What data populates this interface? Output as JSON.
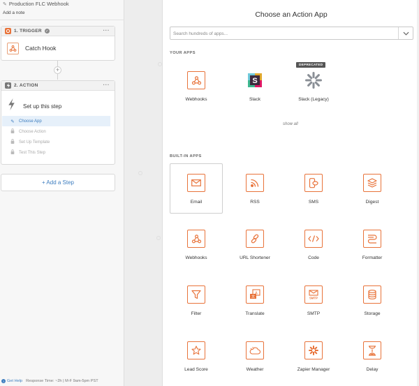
{
  "zap": {
    "title": "Production FLC Webhook",
    "add_note": "Add a note"
  },
  "trigger": {
    "header": "1. TRIGGER",
    "app_label": "Catch Hook",
    "menu": "···"
  },
  "action": {
    "header": "2. ACTION",
    "title": "Set up this step",
    "menu": "···",
    "substeps": [
      {
        "label": "Choose App",
        "state": "active"
      },
      {
        "label": "Choose Action",
        "state": "locked"
      },
      {
        "label": "Set Up Template",
        "state": "locked"
      },
      {
        "label": "Test This Step",
        "state": "locked"
      }
    ]
  },
  "add_step_label": "+ Add a Step",
  "footer": {
    "help": "Get Help",
    "response": "Response Time: ~2h | M-F 9am-5pm PST"
  },
  "modal": {
    "title": "Choose an Action App",
    "search_placeholder": "Search hundreds of apps...",
    "your_apps_label": "YOUR APPS",
    "your_apps": [
      {
        "name": "Webhooks",
        "icon": "webhooks-icon"
      },
      {
        "name": "Slack",
        "icon": "slack-icon"
      },
      {
        "name": "Slack (Legacy)",
        "icon": "slack-legacy-icon",
        "badge": "DEPRECATED"
      }
    ],
    "show_all": "show all",
    "built_in_label": "BUILT-IN APPS",
    "built_in_apps": [
      {
        "name": "Email",
        "icon": "email-icon",
        "selected": true
      },
      {
        "name": "RSS",
        "icon": "rss-icon"
      },
      {
        "name": "SMS",
        "icon": "sms-icon"
      },
      {
        "name": "Digest",
        "icon": "digest-icon"
      },
      {
        "name": "Webhooks",
        "icon": "webhooks-icon"
      },
      {
        "name": "URL Shortener",
        "icon": "link-icon"
      },
      {
        "name": "Code",
        "icon": "code-icon"
      },
      {
        "name": "Formatter",
        "icon": "formatter-icon"
      },
      {
        "name": "Filter",
        "icon": "filter-icon"
      },
      {
        "name": "Translate",
        "icon": "translate-icon"
      },
      {
        "name": "SMTP",
        "icon": "smtp-icon"
      },
      {
        "name": "Storage",
        "icon": "storage-icon"
      },
      {
        "name": "Lead Score",
        "icon": "lead-score-icon"
      },
      {
        "name": "Weather",
        "icon": "weather-icon"
      },
      {
        "name": "Zapier Manager",
        "icon": "zapier-manager-icon"
      },
      {
        "name": "Delay",
        "icon": "delay-icon"
      }
    ]
  },
  "colors": {
    "accent": "#e8733a",
    "link": "#3d7dbf",
    "panel": "#f7f7f7"
  }
}
